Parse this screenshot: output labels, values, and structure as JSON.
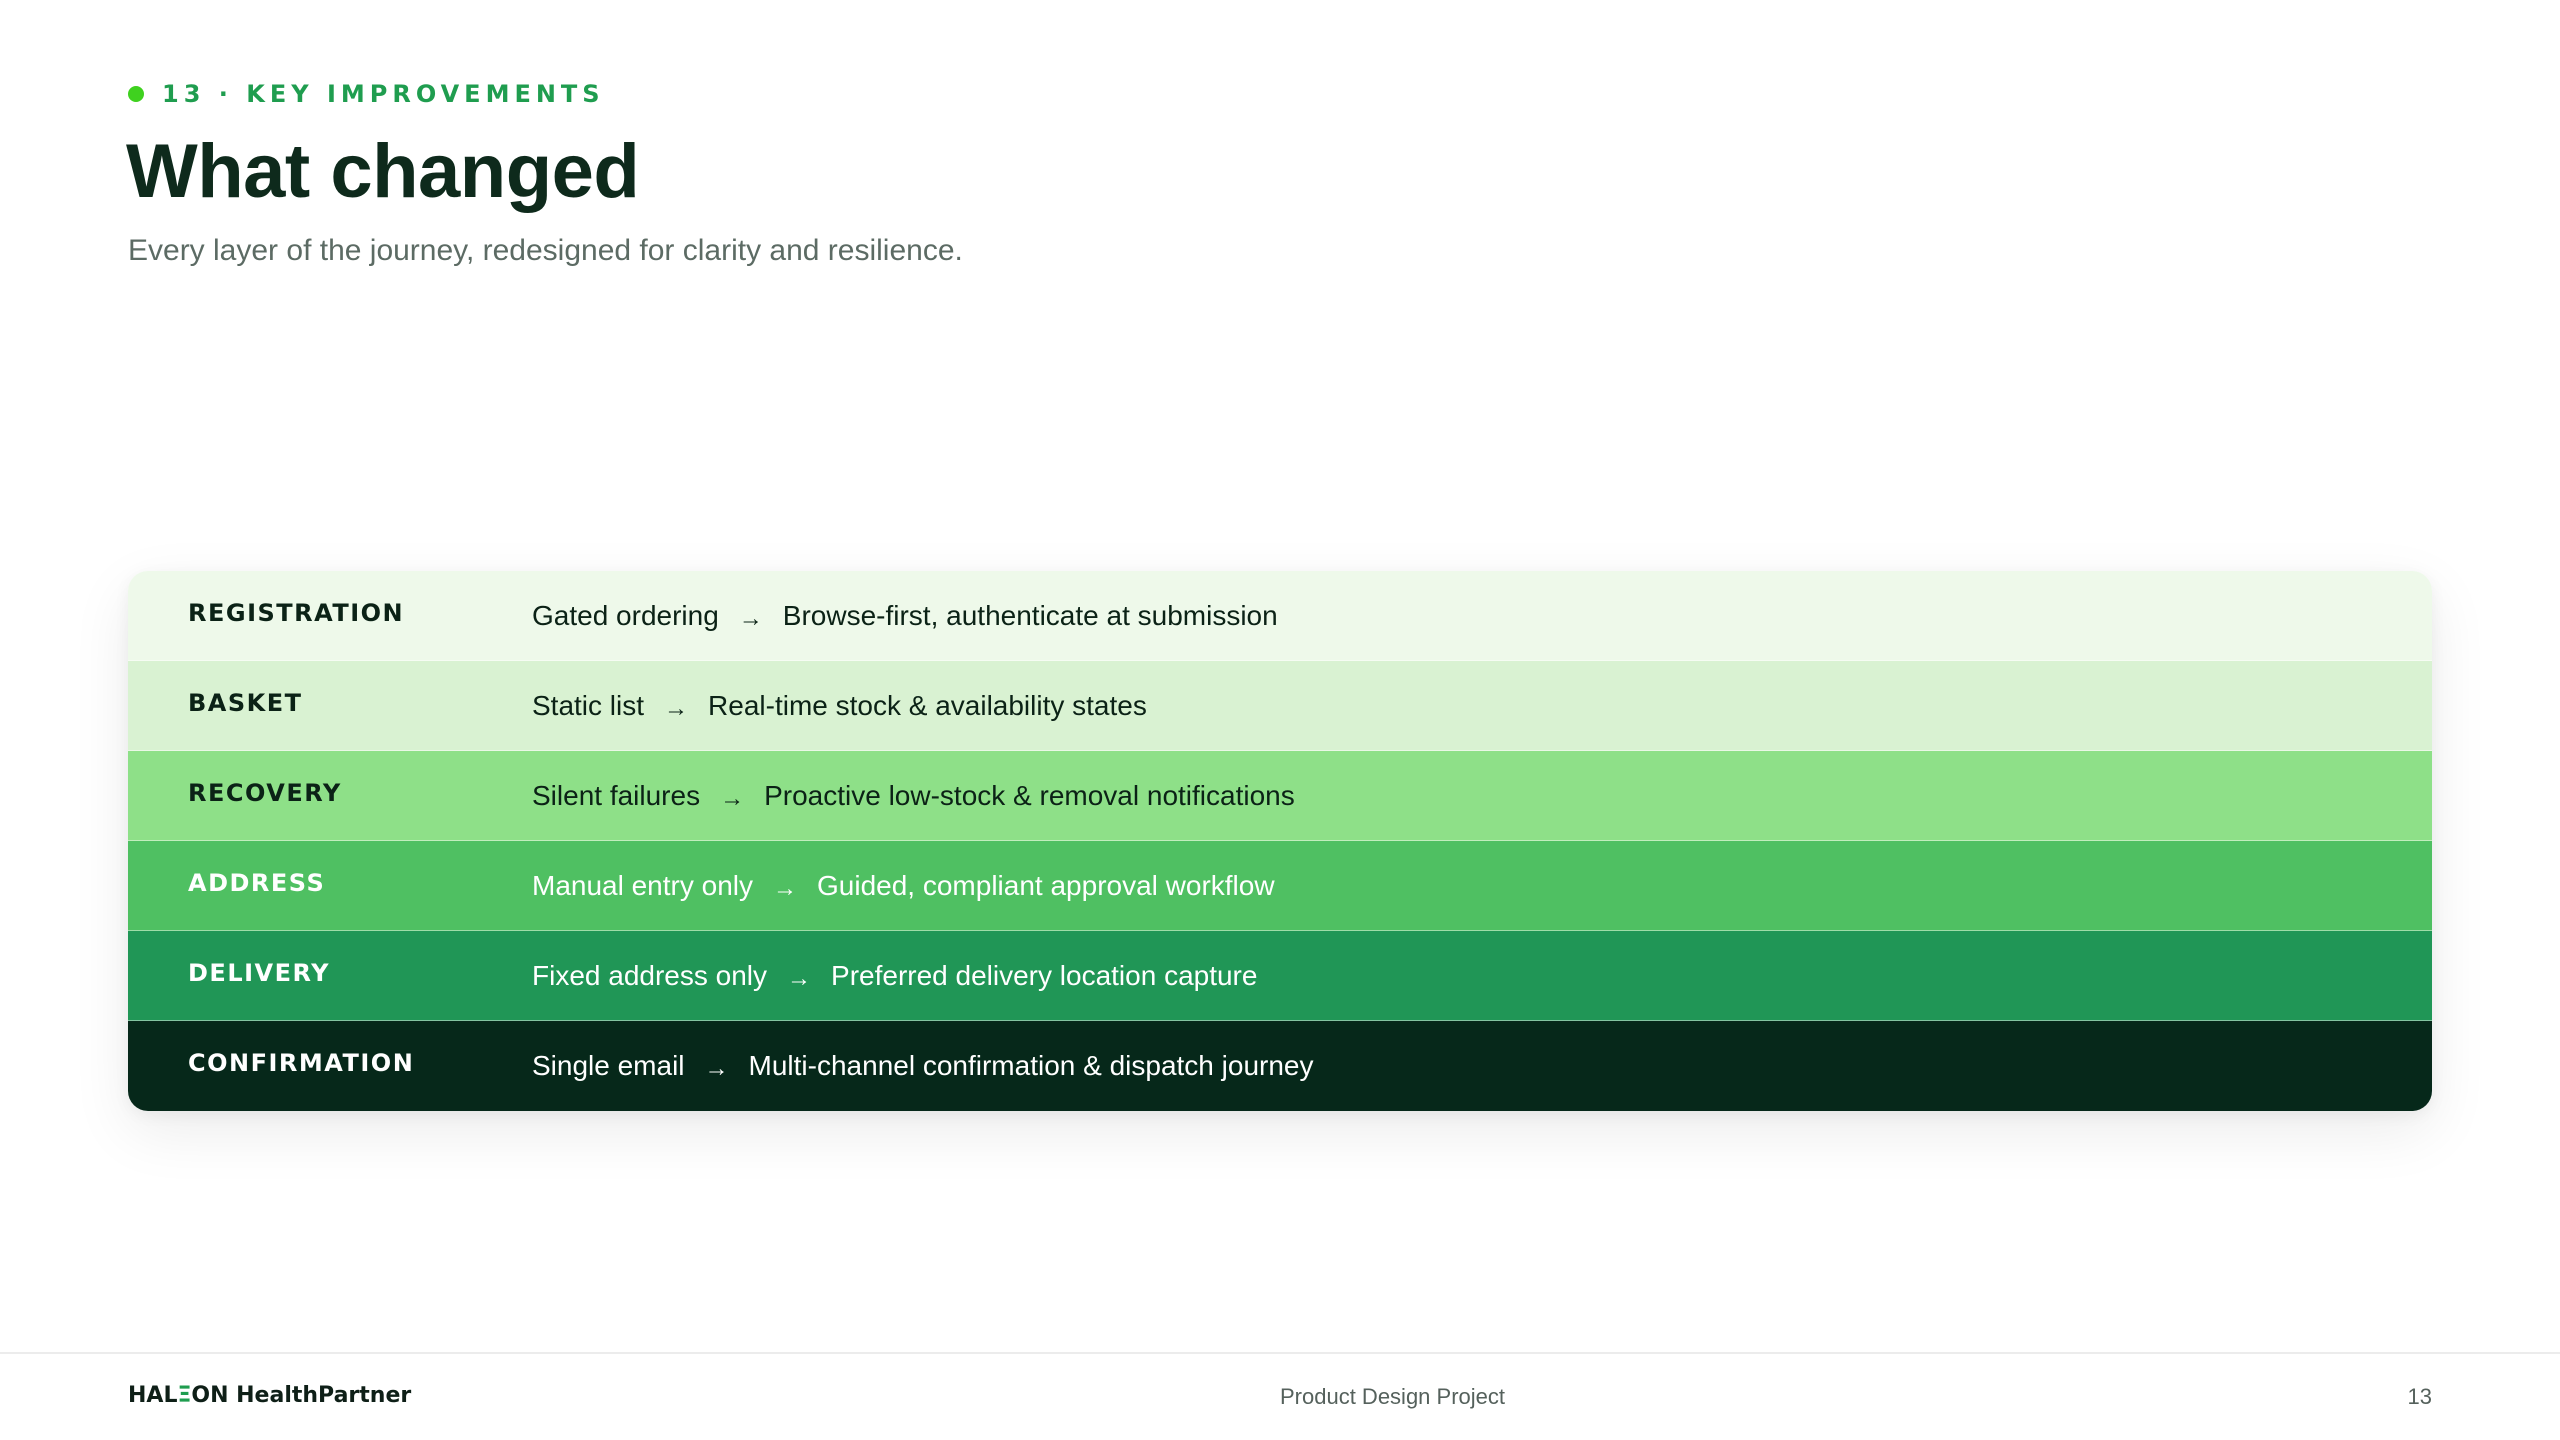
{
  "header": {
    "eyebrow": "13 · KEY IMPROVEMENTS",
    "title": "What changed",
    "subtitle": "Every layer of the journey, redesigned for clarity and resilience."
  },
  "improvements": [
    {
      "label": "REGISTRATION",
      "before": "Gated ordering",
      "after": "Browse-first, authenticate at submission",
      "color": "#eef9ea"
    },
    {
      "label": "BASKET",
      "before": "Static list",
      "after": "Real-time stock & availability states",
      "color": "#d9f2d2"
    },
    {
      "label": "RECOVERY",
      "before": "Silent failures",
      "after": "Proactive low-stock & removal notifications",
      "color": "#8ee088"
    },
    {
      "label": "ADDRESS",
      "before": "Manual entry only",
      "after": "Guided, compliant approval workflow",
      "color": "#4fc062"
    },
    {
      "label": "DELIVERY",
      "before": "Fixed address only",
      "after": "Preferred delivery location capture",
      "color": "#209656"
    },
    {
      "label": "CONFIRMATION",
      "before": "Single email",
      "after": "Multi-channel confirmation & dispatch journey",
      "color": "#06281a"
    }
  ],
  "arrow": "→",
  "footer": {
    "brand_prefix": "HAL",
    "brand_mark": "Ξ",
    "brand_suffix": "ON HealthPartner",
    "center": "Product Design Project",
    "page": "13"
  },
  "colors": {
    "accent": "#1f9d4f",
    "dot": "#3fd11f",
    "title": "#0e2a1c"
  }
}
